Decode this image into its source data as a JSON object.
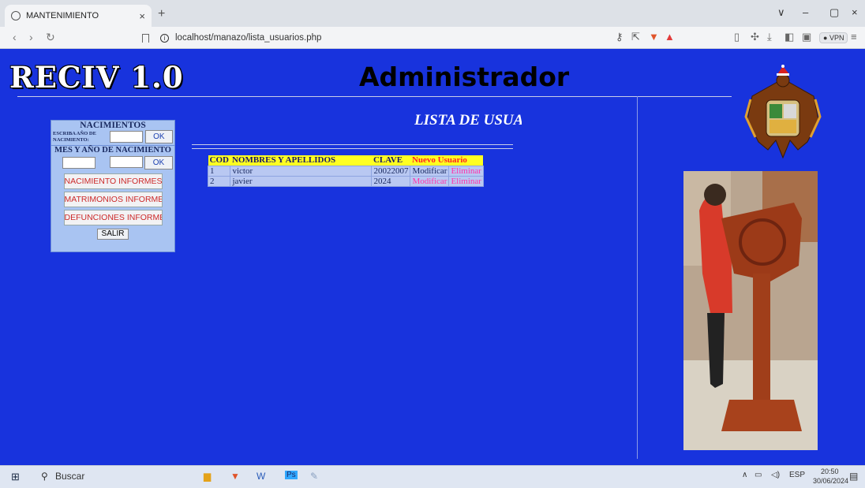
{
  "browser": {
    "tab_title": "MANTENIMIENTO",
    "tab_close": "×",
    "new_tab": "+",
    "url": "localhost/manazo/lista_usuarios.php",
    "vpn_label": "VPN",
    "window_controls": [
      "∨",
      "–",
      "▢",
      "×"
    ]
  },
  "header": {
    "logo": "RECIV 1.0",
    "title": "Administrador"
  },
  "sidebar": {
    "heading": "NACIMIENTOS",
    "field1_label": "ESCRIBA AÑO DE NACIMIENTO:",
    "ok_label": "OK",
    "subheading": "MES Y AÑO DE NACIMIENTO",
    "ok2_label": "OK",
    "buttons": [
      "NACIMIENTO INFORMES",
      "MATRIMONIOS INFORMES",
      "DEFUNCIONES INFORMES"
    ],
    "salir_label": "SALIR"
  },
  "main": {
    "list_title": "LISTA DE USUARIOS",
    "table": {
      "headers": [
        "COD",
        "NOMBRES Y APELLIDOS",
        "CLAVE",
        "Nuevo Usuario"
      ],
      "rows": [
        {
          "cod": "1",
          "name": "victor",
          "clave": "20022007",
          "modify": "Modificar",
          "delete": "Eliminar"
        },
        {
          "cod": "2",
          "name": "javier",
          "clave": "2024",
          "modify": "Modificar",
          "delete": "Eliminar"
        }
      ]
    }
  },
  "taskbar": {
    "search_label": "Buscar",
    "lang": "ESP",
    "time": "20:50",
    "date": "30/06/2024"
  }
}
